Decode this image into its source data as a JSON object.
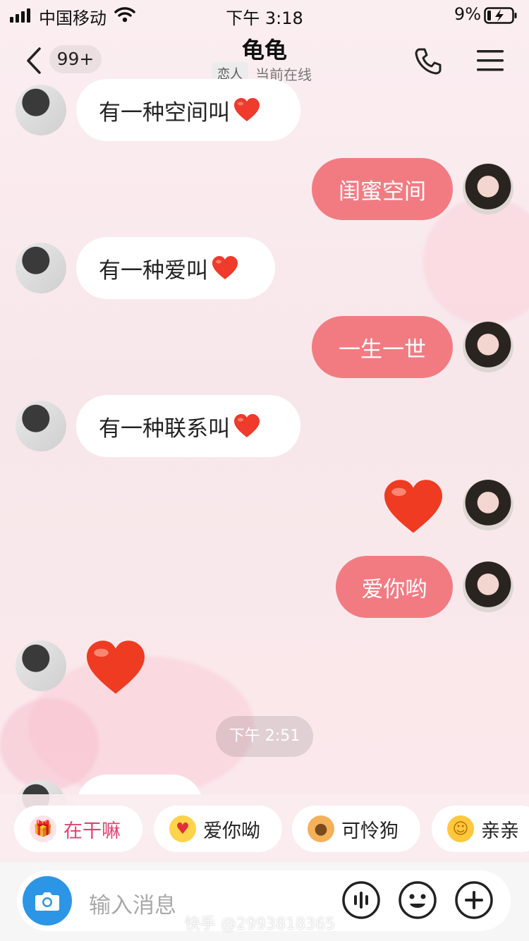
{
  "status_bar": {
    "carrier": "中国移动",
    "time": "下午 3:18",
    "battery": "9%"
  },
  "header": {
    "unread": "99+",
    "title": "龟龟",
    "relation_tag": "恋人",
    "status": "当前在线"
  },
  "messages": [
    {
      "side": "left",
      "text": "有一种空间叫",
      "heart": true
    },
    {
      "side": "right",
      "text": "闺蜜空间"
    },
    {
      "side": "left",
      "text": "有一种爱叫",
      "heart": true
    },
    {
      "side": "right",
      "text": "一生一世"
    },
    {
      "side": "left",
      "text": "有一种联系叫",
      "heart": true
    },
    {
      "side": "right",
      "type": "big-heart"
    },
    {
      "side": "right",
      "text": "爱你哟"
    },
    {
      "side": "left",
      "type": "big-heart"
    }
  ],
  "timestamp": "下午 2:51",
  "quick_replies": [
    {
      "label": "在干嘛",
      "icon": "gift-face-icon",
      "color": "#e0436f"
    },
    {
      "label": "爱你呦",
      "icon": "heart-eyes-emoji-icon",
      "color": "#222222"
    },
    {
      "label": "可怜狗",
      "icon": "puppy-face-icon",
      "color": "#222222"
    },
    {
      "label": "亲亲",
      "icon": "hug-emoji-icon",
      "color": "#222222"
    }
  ],
  "input": {
    "placeholder": "输入消息"
  },
  "watermark": "快手 @2993818365",
  "colors": {
    "bubble_out": "#f27b82",
    "bubble_in": "#ffffff",
    "camera_button": "#2d95e6"
  }
}
